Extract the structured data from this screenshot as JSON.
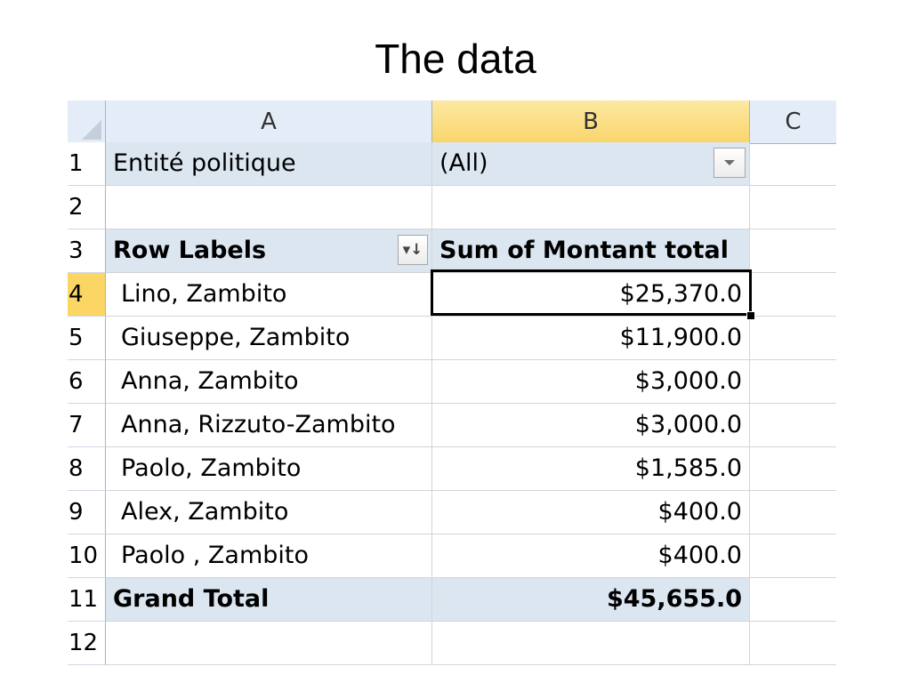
{
  "slide": {
    "title": "The data"
  },
  "sheet": {
    "columns": [
      "A",
      "B",
      "C"
    ],
    "filter": {
      "row": "1",
      "label": "Entité politique",
      "value": "(All)"
    },
    "empty_rows": [
      "2",
      "12"
    ],
    "pivot_header": {
      "row": "3",
      "row_labels": "Row Labels",
      "sum_label": "Sum of Montant total"
    },
    "rows": [
      {
        "row": "4",
        "label": "Lino, Zambito",
        "value": "$25,370.0"
      },
      {
        "row": "5",
        "label": "Giuseppe, Zambito",
        "value": "$11,900.0"
      },
      {
        "row": "6",
        "label": "Anna, Zambito",
        "value": "$3,000.0"
      },
      {
        "row": "7",
        "label": "Anna, Rizzuto-Zambito",
        "value": "$3,000.0"
      },
      {
        "row": "8",
        "label": "Paolo, Zambito",
        "value": "$1,585.0"
      },
      {
        "row": "9",
        "label": "Alex, Zambito",
        "value": "$400.0"
      },
      {
        "row": "10",
        "label": "Paolo , Zambito",
        "value": "$400.0"
      }
    ],
    "grand_total": {
      "row": "11",
      "label": "Grand Total",
      "value": "$45,655.0"
    },
    "sort_icon_glyph": "▾↓",
    "colors": {
      "pivot_header_fill": "#dce6f1",
      "active_header_fill": "#fbd665",
      "selection_border": "#000000"
    }
  }
}
